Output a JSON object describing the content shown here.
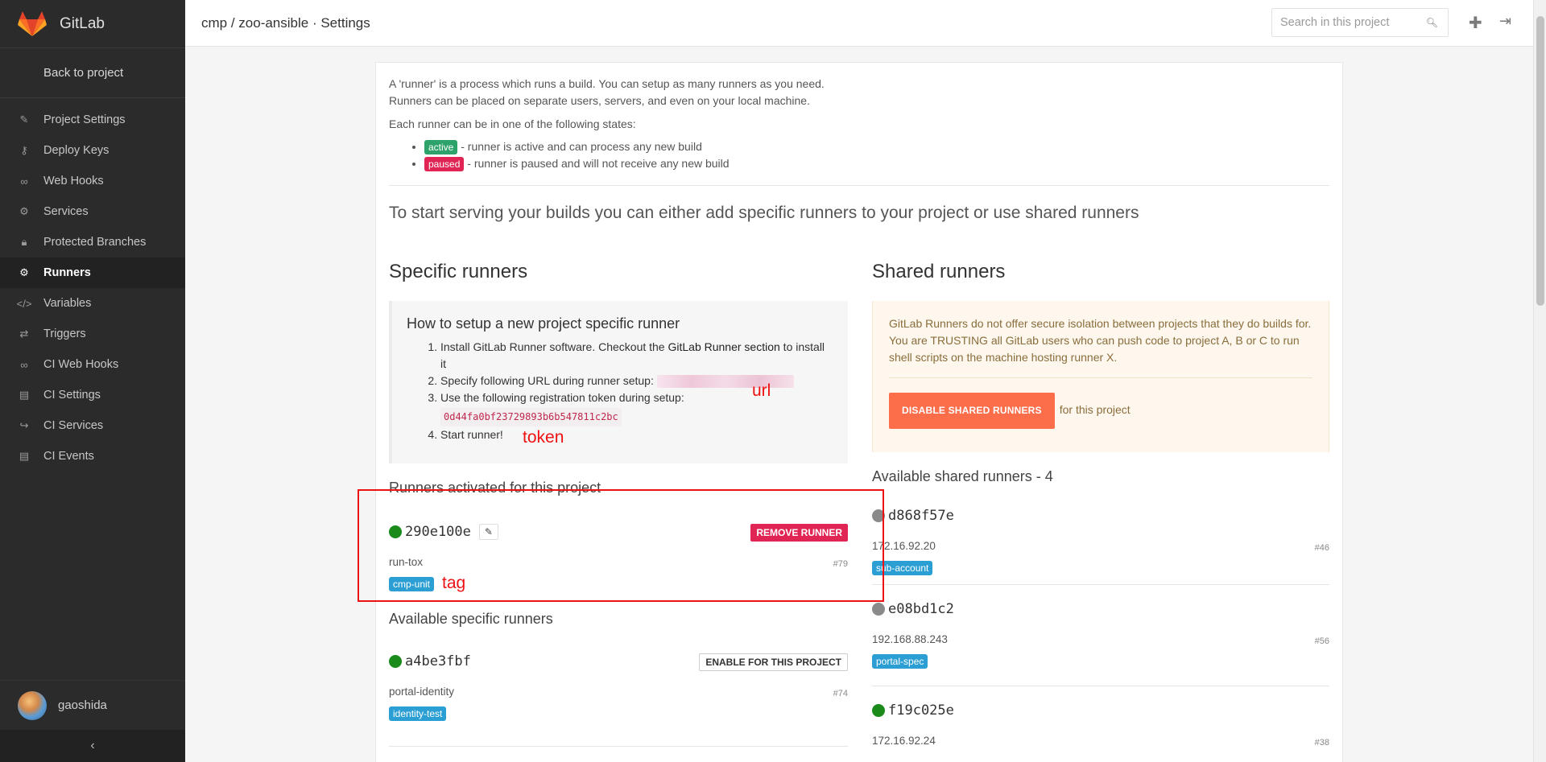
{
  "sidebar": {
    "brand": "GitLab",
    "back": "Back to project",
    "items": [
      {
        "label": "Project Settings",
        "icon": "edit-icon"
      },
      {
        "label": "Deploy Keys",
        "icon": "key-icon"
      },
      {
        "label": "Web Hooks",
        "icon": "link-icon"
      },
      {
        "label": "Services",
        "icon": "cogs-icon"
      },
      {
        "label": "Protected Branches",
        "icon": "lock-icon"
      },
      {
        "label": "Runners",
        "icon": "gear-icon",
        "active": true
      },
      {
        "label": "Variables",
        "icon": "code-icon"
      },
      {
        "label": "Triggers",
        "icon": "retweet-icon"
      },
      {
        "label": "CI Web Hooks",
        "icon": "link-icon"
      },
      {
        "label": "CI Settings",
        "icon": "book-icon"
      },
      {
        "label": "CI Services",
        "icon": "share-icon"
      },
      {
        "label": "CI Events",
        "icon": "book-icon"
      }
    ],
    "username": "gaoshida",
    "collapse": "‹"
  },
  "header": {
    "breadcrumb": "cmp / zoo-ansible · Settings",
    "search_placeholder": "Search in this project"
  },
  "intro": {
    "line1": "A 'runner' is a process which runs a build. You can setup as many runners as you need.",
    "line2": "Runners can be placed on separate users, servers, and even on your local machine.",
    "states_heading": "Each runner can be in one of the following states:",
    "active_label": "active",
    "active_text": " - runner is active and can process any new build",
    "paused_label": "paused",
    "paused_text": " - runner is paused and will not receive any new build",
    "lead": "To start serving your builds you can either add specific runners to your project or use shared runners"
  },
  "specific": {
    "title": "Specific runners",
    "setup_title": "How to setup a new project specific runner",
    "step1_a": "Install GitLab Runner software. Checkout the ",
    "step1_link": "GitLab Runner section",
    "step1_b": " to install it",
    "step2": "Specify following URL during runner setup:",
    "step3": "Use the following registration token during setup:",
    "token": "0d44fa0bf23729893b6b547811c2bc",
    "step4": "Start runner!",
    "annotation_url": "url",
    "annotation_token": "token",
    "activated_title": "Runners activated for this project",
    "activated": [
      {
        "id": "290e100e",
        "desc": "run-tox",
        "num": "#79",
        "tag": "cmp-unit",
        "status": "green",
        "action": "REMOVE RUNNER"
      }
    ],
    "annotation_tag": "tag",
    "available_title": "Available specific runners",
    "available": [
      {
        "id": "a4be3fbf",
        "desc": "portal-identity",
        "num": "#74",
        "tag": "identity-test",
        "status": "green",
        "action": "ENABLE FOR THIS PROJECT"
      }
    ]
  },
  "shared": {
    "title": "Shared runners",
    "warning": "GitLab Runners do not offer secure isolation between projects that they do builds for. You are TRUSTING all GitLab users who can push code to project A, B or C to run shell scripts on the machine hosting runner X.",
    "disable_button": "DISABLE SHARED RUNNERS",
    "for_project": "for this project",
    "available_title": "Available shared runners - 4",
    "runners": [
      {
        "id": "d868f57e",
        "desc": "172.16.92.20",
        "num": "#46",
        "tag": "sub-account",
        "status": "grey"
      },
      {
        "id": "e08bd1c2",
        "desc": "192.168.88.243",
        "num": "#56",
        "tag": "portal-spec",
        "status": "grey"
      },
      {
        "id": "f19c025e",
        "desc": "172.16.92.24",
        "num": "#38",
        "tag": "",
        "status": "green"
      }
    ]
  },
  "colors": {
    "sidebar_bg": "#2b2b2b",
    "accent_orange": "#fc6d4a",
    "remove_red": "#e02454",
    "active_green": "#2ea26b",
    "tag_blue": "#2b9ed3",
    "annotation_red": "#ee1111"
  }
}
